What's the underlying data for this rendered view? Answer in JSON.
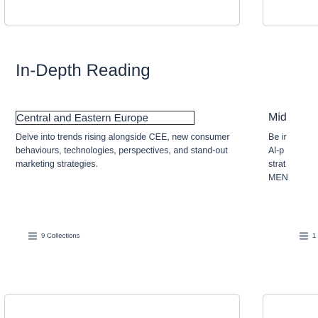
{
  "section": {
    "title": "In-Depth Reading"
  },
  "collections": [
    {
      "title": "Central and Eastern Europe",
      "description": "Delve into trends rising alongside CEE, new consumer behaviours, technologies, perspectives, and stand-out marketing strategies.",
      "count_label": "9 Collections",
      "icon": "collections-stack-icon"
    },
    {
      "title": "Mid",
      "description_lines": [
        "Be ir",
        "Al-p",
        "strat",
        "MEN"
      ],
      "count_label": "1",
      "icon": "collections-stack-icon"
    }
  ]
}
